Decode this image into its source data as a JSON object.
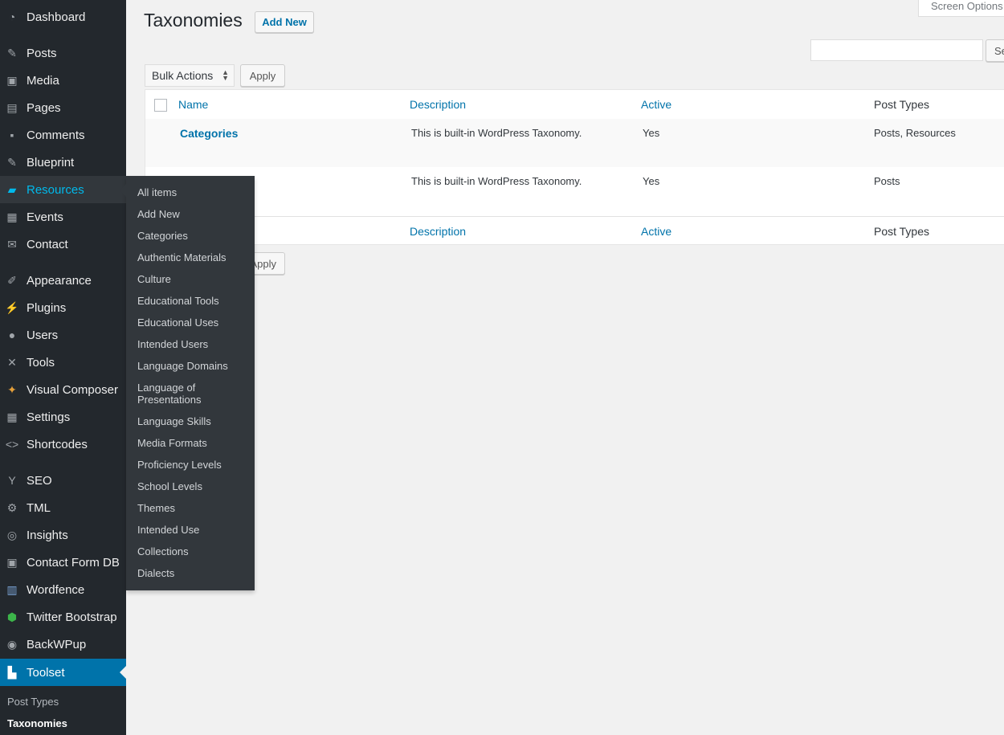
{
  "sidebar": {
    "items": [
      {
        "label": "Dashboard",
        "icon": "dashboard-icon"
      },
      {
        "label": "Posts",
        "icon": "pin-icon"
      },
      {
        "label": "Media",
        "icon": "media-icon"
      },
      {
        "label": "Pages",
        "icon": "pages-icon"
      },
      {
        "label": "Comments",
        "icon": "comment-icon"
      },
      {
        "label": "Blueprint",
        "icon": "pin-icon"
      },
      {
        "label": "Resources",
        "icon": "folder-icon"
      },
      {
        "label": "Events",
        "icon": "calendar-icon"
      },
      {
        "label": "Contact",
        "icon": "envelope-icon"
      },
      {
        "label": "Appearance",
        "icon": "brush-icon"
      },
      {
        "label": "Plugins",
        "icon": "plug-icon"
      },
      {
        "label": "Users",
        "icon": "user-icon"
      },
      {
        "label": "Tools",
        "icon": "wrench-icon"
      },
      {
        "label": "Visual Composer",
        "icon": "visual-composer-icon"
      },
      {
        "label": "Settings",
        "icon": "settings-icon"
      },
      {
        "label": "Shortcodes",
        "icon": "code-icon"
      },
      {
        "label": "SEO",
        "icon": "yoast-icon"
      },
      {
        "label": "TML",
        "icon": "gear-icon"
      },
      {
        "label": "Insights",
        "icon": "insights-icon"
      },
      {
        "label": "Contact Form DB",
        "icon": "database-icon"
      },
      {
        "label": "Wordfence",
        "icon": "wordfence-icon"
      },
      {
        "label": "Twitter Bootstrap",
        "icon": "shield-icon"
      },
      {
        "label": "BackWPup",
        "icon": "backup-icon"
      },
      {
        "label": "Toolset",
        "icon": "toolset-icon"
      }
    ],
    "toolset_submenu": [
      {
        "label": "Post Types"
      },
      {
        "label": "Taxonomies"
      }
    ]
  },
  "flyout": {
    "items": [
      "All items",
      "Add New",
      "Categories",
      "Authentic Materials",
      "Culture",
      "Educational Tools",
      "Educational Uses",
      "Intended Users",
      "Language Domains",
      "Language of Presentations",
      "Language Skills",
      "Media Formats",
      "Proficiency Levels",
      "School Levels",
      "Themes",
      "Intended Use",
      "Collections",
      "Dialects"
    ]
  },
  "header": {
    "title": "Taxonomies",
    "add_new_label": "Add New",
    "screen_options_label": "Screen Options",
    "search_button_label": "Search"
  },
  "bulk": {
    "select_label": "Bulk Actions",
    "apply_label": "Apply",
    "apply_bottom_label": "Apply"
  },
  "table": {
    "columns": [
      "Name",
      "Description",
      "Active",
      "Post Types"
    ],
    "rows": [
      {
        "name": "Categories",
        "description": "This is built-in WordPress Taxonomy.",
        "active": "Yes",
        "post_types": "Posts, Resources"
      },
      {
        "name": "",
        "description": "This is built-in WordPress Taxonomy.",
        "active": "Yes",
        "post_types": "Posts"
      }
    ]
  },
  "colors": {
    "sidebar_bg": "#23282d",
    "flyout_bg": "#32373c",
    "accent": "#0073aa",
    "current_text": "#00b9eb"
  }
}
